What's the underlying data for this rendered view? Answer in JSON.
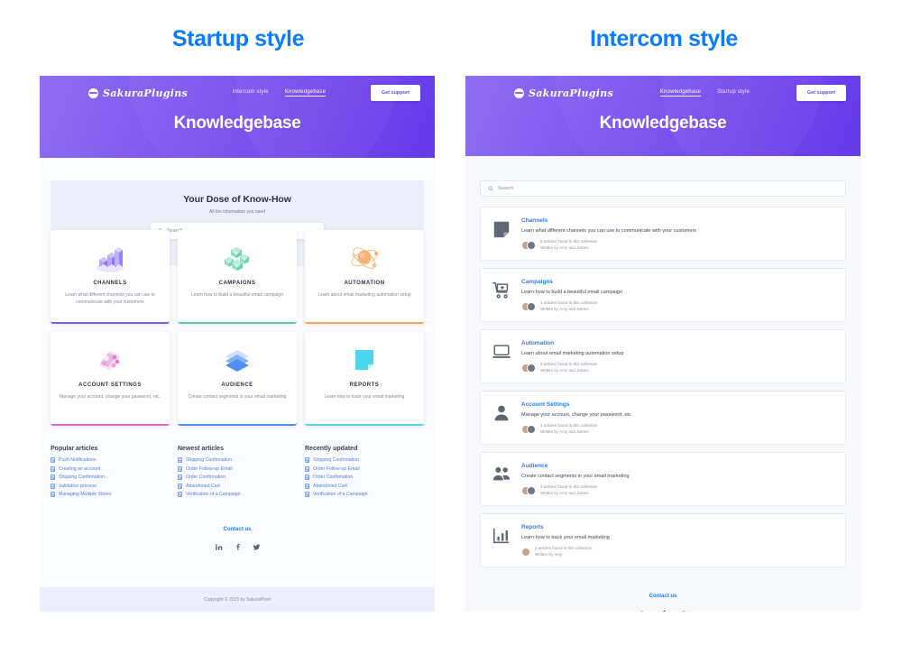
{
  "panels": {
    "left_heading": "Startup style",
    "right_heading": "Intercom style",
    "accent_blue": "#0a7cff"
  },
  "brand": {
    "name": "SakuraPlugins",
    "logo_icon": "sakura-mark-icon"
  },
  "left": {
    "nav": {
      "links": [
        {
          "label": "Intercom style",
          "active": false
        },
        {
          "label": "Knowledgebase",
          "active": true
        }
      ],
      "support_button": "Get support"
    },
    "hero_title": "Knowledgebase",
    "knowhow": {
      "title": "Your Dose of Know-How",
      "subtitle": "All the information you need",
      "search_placeholder": "Search"
    },
    "cards": [
      {
        "title": "CHANNELS",
        "desc": "Learn what different channels you can use to communicate with your customers",
        "icon": "bar-chart-3d-icon",
        "accent": "#7b5cf0"
      },
      {
        "title": "CAMPAIGNS",
        "desc": "Learn how to build a beautiful email campaign",
        "icon": "boxes-3d-icon",
        "accent": "#5ccfa3"
      },
      {
        "title": "AUTOMATION",
        "desc": "Learn about email marketing automation setup",
        "icon": "atom-orbit-icon",
        "accent": "#f0a45c"
      },
      {
        "title": "ACCOUNT SETTINGS",
        "desc": "Manage your account, change your password, etc.",
        "icon": "user-settings-3d-icon",
        "accent": "#e469c8"
      },
      {
        "title": "AUDIENCE",
        "desc": "Create contact segments in your email marketing",
        "icon": "layers-3d-icon",
        "accent": "#4e8ef5"
      },
      {
        "title": "REPORTS",
        "desc": "Learn how to track your email marketing",
        "icon": "document-square-icon",
        "accent": "#4fd7ee"
      }
    ],
    "lists": [
      {
        "title": "Popular articles",
        "items": [
          "Push Notifications",
          "Creating an account",
          "Shipping Confirmation",
          "Validation process",
          "Managing Multiple Stores"
        ]
      },
      {
        "title": "Newest articles",
        "items": [
          "Shipping Confirmation",
          "Order Follow-up Email",
          "Order Confirmation",
          "Abandoned Cart",
          "Verification of a Campaign"
        ]
      },
      {
        "title": "Recently updated",
        "items": [
          "Shipping Confirmation",
          "Order Follow-up Email",
          "Order Confirmation",
          "Abandoned Cart",
          "Verification of a Campaign"
        ]
      }
    ],
    "footer": {
      "contact": "Contact us",
      "socials": [
        "linkedin-icon",
        "facebook-icon",
        "twitter-icon"
      ],
      "copyright": "Copyright © 2015 by SakuraPixel"
    }
  },
  "right": {
    "nav": {
      "links": [
        {
          "label": "Knowledgebase",
          "active": true
        },
        {
          "label": "Startup style",
          "active": false
        }
      ],
      "support_button": "Get support"
    },
    "hero_title": "Knowledgebase",
    "search_placeholder": "Search",
    "collections": [
      {
        "title": "Channels",
        "desc": "Learn what different channels you can use to communicate with your customers",
        "count": "5 articles found in this collection",
        "authors": "Written by Amy and James",
        "author_names": [
          "Amy",
          "James"
        ],
        "icon": "document-square-icon"
      },
      {
        "title": "Campaigns",
        "desc": "Learn how to build a beautiful email campaign",
        "count": "3 articles found in this collection",
        "authors": "Written by Amy and James",
        "author_names": [
          "Amy",
          "James"
        ],
        "icon": "shopping-cart-icon"
      },
      {
        "title": "Automation",
        "desc": "Learn about email marketing automation setup",
        "count": "3 articles found in this collection",
        "authors": "Written by Amy and James",
        "author_names": [
          "Amy",
          "James"
        ],
        "icon": "laptop-icon"
      },
      {
        "title": "Account Settings",
        "desc": "Manage your account, change your password, etc.",
        "count": "3 articles found in this collection",
        "authors": "Written by Amy and James",
        "author_names": [
          "Amy",
          "James"
        ],
        "icon": "user-icon"
      },
      {
        "title": "Audience",
        "desc": "Create contact segments in your email marketing",
        "count": "3 articles found in this collection",
        "authors": "Written by Amy and James",
        "author_names": [
          "Amy",
          "James"
        ],
        "icon": "users-group-icon"
      },
      {
        "title": "Reports",
        "desc": "Learn how to track your email marketing",
        "count": "2 articles found in this collection",
        "authors": "Written by Amy",
        "author_names": [
          "Amy"
        ],
        "icon": "bar-chart-icon"
      }
    ],
    "footer": {
      "contact": "Contact us",
      "socials": [
        "linkedin-icon",
        "facebook-icon",
        "twitter-icon"
      ]
    }
  }
}
